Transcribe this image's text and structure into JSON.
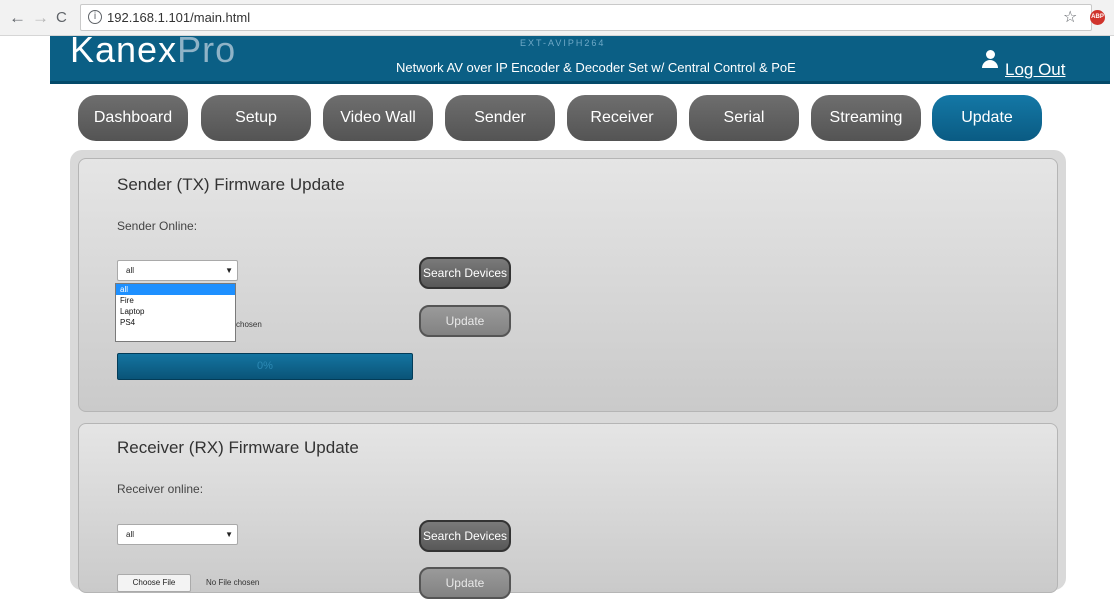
{
  "browser": {
    "back": "←",
    "forward": "→",
    "reload": "C",
    "url": "192.168.1.101/main.html"
  },
  "header": {
    "logo_main": "Kanex",
    "logo_pro": "Pro",
    "model": "EXT-AVIPH264",
    "subtitle": "Network AV over IP Encoder & Decoder Set w/ Central Control & PoE",
    "logout": "Log Out"
  },
  "tabs": [
    {
      "label": "Dashboard"
    },
    {
      "label": "Setup"
    },
    {
      "label": "Video Wall"
    },
    {
      "label": "Sender"
    },
    {
      "label": "Receiver"
    },
    {
      "label": "Serial"
    },
    {
      "label": "Streaming"
    },
    {
      "label": "Update",
      "active": true
    }
  ],
  "sender": {
    "title": "Sender (TX) Firmware Update",
    "online_label": "Sender Online:",
    "select_value": "all",
    "options": [
      "all",
      "Fire",
      "Laptop",
      "PS4"
    ],
    "search_button": "Search Devices",
    "update_button": "Update",
    "file_status": "chosen",
    "progress": "0%"
  },
  "receiver": {
    "title": "Receiver (RX) Firmware Update",
    "online_label": "Receiver online:",
    "select_value": "all",
    "search_button": "Search Devices",
    "choose_file": "Choose File",
    "file_status": "No File chosen",
    "update_button": "Update"
  },
  "colors": {
    "brand": "#0b5f85",
    "tab": "#616161",
    "tab_active": "#0f6a94",
    "selection": "#1e90ff"
  }
}
